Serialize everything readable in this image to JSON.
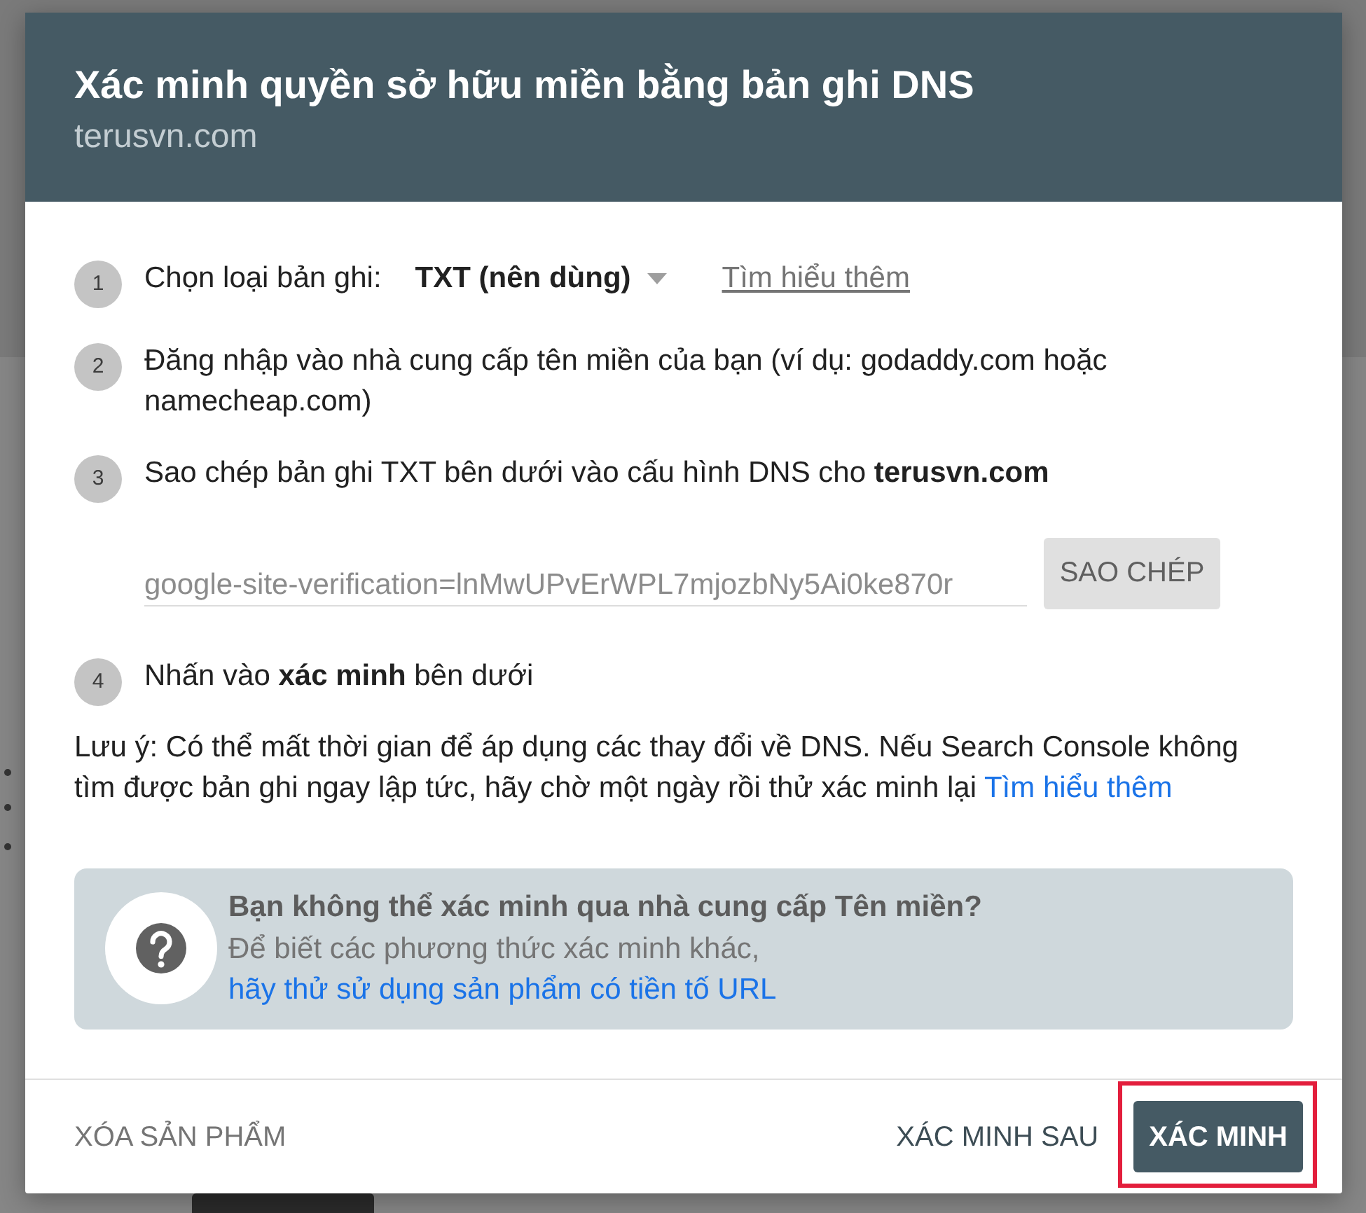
{
  "dialog": {
    "title": "Xác minh quyền sở hữu miền bằng bản ghi DNS",
    "subtitle": "terusvn.com"
  },
  "steps": [
    {
      "number": "1",
      "kind": "select",
      "label": "Chọn loại bản ghi:",
      "select": {
        "value": "TXT (nên dùng)"
      },
      "link": "Tìm hiểu thêm"
    },
    {
      "number": "2",
      "kind": "text",
      "text": "Đăng nhập vào nhà cung cấp tên miền của bạn (ví dụ: godaddy.com hoặc namecheap.com)"
    },
    {
      "number": "3",
      "kind": "text",
      "text": "Sao chép bản ghi TXT bên dưới vào cấu hình DNS cho **terusvn.com**",
      "record": {
        "value": "google-site-verification=lnMwUPvErWPL7mjozbNy5Ai0ke870r",
        "copy_button": "SAO CHÉP"
      }
    },
    {
      "number": "4",
      "kind": "text",
      "text": "Nhấn vào **xác minh** bên dưới"
    }
  ],
  "note": {
    "text": "Lưu ý: Có thể mất thời gian để áp dụng các thay đổi về DNS. Nếu Search Console không tìm được bản ghi ngay lập tức, hãy chờ một ngày rồi thử xác minh lại",
    "link": "Tìm hiểu thêm"
  },
  "alternative": {
    "title": "Bạn không thể xác minh qua nhà cung cấp Tên miền?",
    "text": "Để biết các phương thức xác minh khác,",
    "link": "hãy thử sử dụng sản phẩm có tiền tố URL"
  },
  "footer": {
    "buttons": [
      {
        "label": "XÓA SẢN PHẨM",
        "kind": "subtle",
        "highlighted": false
      },
      {
        "label": "XÁC MINH SAU",
        "kind": "text",
        "highlighted": false
      },
      {
        "label": "XÁC MINH",
        "kind": "primary",
        "highlighted": true
      }
    ]
  }
}
